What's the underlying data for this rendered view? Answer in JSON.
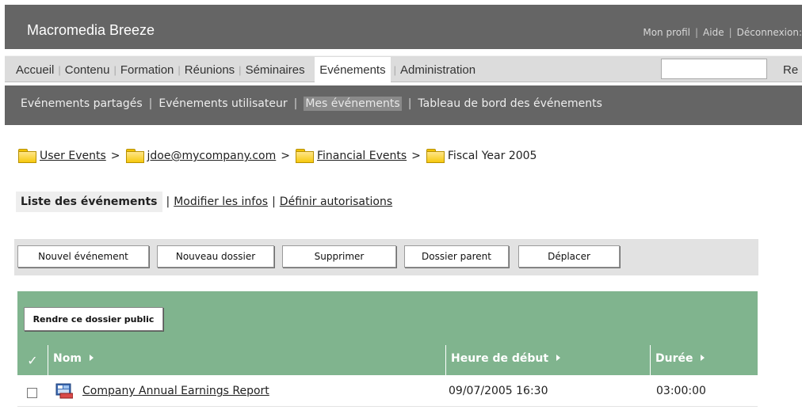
{
  "header": {
    "brand": "Macromedia Breeze",
    "links": [
      "Mon profil",
      "Aide",
      "Déconnexion:"
    ]
  },
  "nav": {
    "items": [
      "Accueil",
      "Contenu",
      "Formation",
      "Réunions",
      "Séminaires",
      "Evénements",
      "Administration"
    ],
    "active": "Evénements",
    "search_button": "Re",
    "search_value": ""
  },
  "subnav": {
    "items": [
      "Evénements partagés",
      "Evénements utilisateur",
      "Mes événements",
      "Tableau de bord des événements"
    ],
    "active": "Mes événements"
  },
  "breadcrumb": {
    "items": [
      "User Events",
      "jdoe@mycompany.com",
      "Financial Events",
      "Fiscal Year 2005"
    ],
    "separator": ">"
  },
  "tabs": {
    "active": "Liste des événements",
    "links": [
      "Modifier les infos",
      "Définir autorisations"
    ]
  },
  "toolbar": {
    "buttons": [
      "Nouvel événement",
      "Nouveau dossier",
      "Supprimer",
      "Dossier parent",
      "Déplacer"
    ]
  },
  "list": {
    "public_button": "Rendre ce dossier public",
    "columns": [
      "Nom",
      "Heure de début",
      "Durée"
    ],
    "rows": [
      {
        "name": "Company Annual Earnings Report",
        "start": "09/07/2005 16:30",
        "duration": "03:00:00"
      }
    ]
  },
  "colors": {
    "header_bg": "#656565",
    "nav_bg": "#dcdcdc",
    "table_green": "#80b48e",
    "folder_yellow": "#f6c90e"
  }
}
